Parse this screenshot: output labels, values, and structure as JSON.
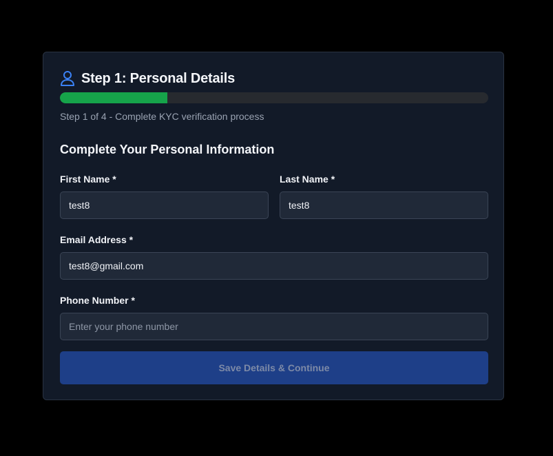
{
  "header": {
    "icon": "user-icon",
    "title": "Step 1: Personal Details"
  },
  "progress": {
    "current_step": 1,
    "total_steps": 4,
    "fraction": 0.25,
    "color": "#16a34a",
    "caption": "Step 1 of 4 - Complete KYC verification process"
  },
  "form": {
    "section_title": "Complete Your Personal Information",
    "first_name": {
      "label": "First Name *",
      "value": "test8"
    },
    "last_name": {
      "label": "Last Name *",
      "value": "test8"
    },
    "email": {
      "label": "Email Address *",
      "value": "test8@gmail.com"
    },
    "phone": {
      "label": "Phone Number *",
      "value": "",
      "placeholder": "Enter your phone number"
    },
    "submit_label": "Save Details & Continue"
  },
  "colors": {
    "accent": "#1e3f88",
    "icon": "#3b82f6",
    "card": "#121a28"
  }
}
